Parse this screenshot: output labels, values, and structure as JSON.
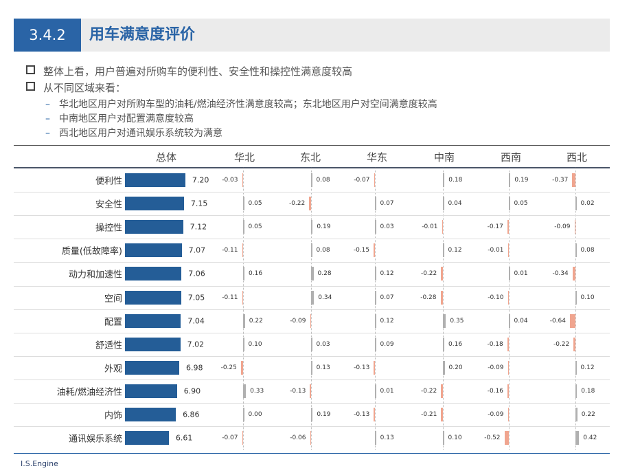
{
  "header": {
    "section": "3.4.2",
    "title": "用车满意度评价"
  },
  "bullets": [
    "整体上看，用户普遍对所购车的便利性、安全性和操控性满意度较高",
    "从不同区域来看："
  ],
  "sub_bullets": [
    "华北地区用户对所购车型的油耗/燃油经济性满意度较高；东北地区用户对空间满意度较高",
    "中南地区用户对配置满意度较高",
    "西北地区用户对通讯娱乐系统较为满意"
  ],
  "footer": "I.S.Engine",
  "colors": {
    "total": "#245d97",
    "positive": "#b0b0b0",
    "negative": "#f0a58f",
    "accent": "#2a64a6"
  },
  "chart_data": {
    "type": "bar",
    "total_label": "总体",
    "regions": [
      "华北",
      "东北",
      "华东",
      "中南",
      "西南",
      "西北"
    ],
    "categories": [
      "便利性",
      "安全性",
      "操控性",
      "质量(低故障率)",
      "动力和加速性",
      "空间",
      "配置",
      "舒适性",
      "外观",
      "油耗/燃油经济性",
      "内饰",
      "通讯娱乐系统"
    ],
    "total": [
      "7.20",
      "7.15",
      "7.12",
      "7.07",
      "7.06",
      "7.05",
      "7.04",
      "7.02",
      "6.98",
      "6.90",
      "6.86",
      "6.61"
    ],
    "diffs": [
      [
        "-0.03",
        "0.08",
        "-0.07",
        "0.18",
        "0.19",
        "-0.37"
      ],
      [
        "0.05",
        "-0.22",
        "0.07",
        "0.04",
        "0.05",
        "0.02"
      ],
      [
        "0.05",
        "0.19",
        "0.03",
        "-0.01",
        "-0.17",
        "-0.09"
      ],
      [
        "-0.11",
        "0.08",
        "-0.15",
        "0.12",
        "-0.01",
        "0.08"
      ],
      [
        "0.16",
        "0.28",
        "0.12",
        "-0.22",
        "0.01",
        "-0.34"
      ],
      [
        "-0.11",
        "0.34",
        "0.07",
        "-0.28",
        "-0.10",
        "0.10"
      ],
      [
        "0.22",
        "-0.09",
        "0.12",
        "0.35",
        "0.04",
        "-0.64"
      ],
      [
        "0.10",
        "0.03",
        "0.09",
        "0.16",
        "-0.18",
        "-0.22"
      ],
      [
        "-0.25",
        "0.13",
        "-0.13",
        "0.20",
        "-0.09",
        "0.12"
      ],
      [
        "0.33",
        "-0.13",
        "0.01",
        "-0.22",
        "-0.16",
        "0.18"
      ],
      [
        "0.00",
        "0.19",
        "-0.13",
        "-0.21",
        "-0.09",
        "0.22"
      ],
      [
        "-0.07",
        "-0.06",
        "0.13",
        "0.10",
        "-0.52",
        "0.42"
      ]
    ]
  }
}
